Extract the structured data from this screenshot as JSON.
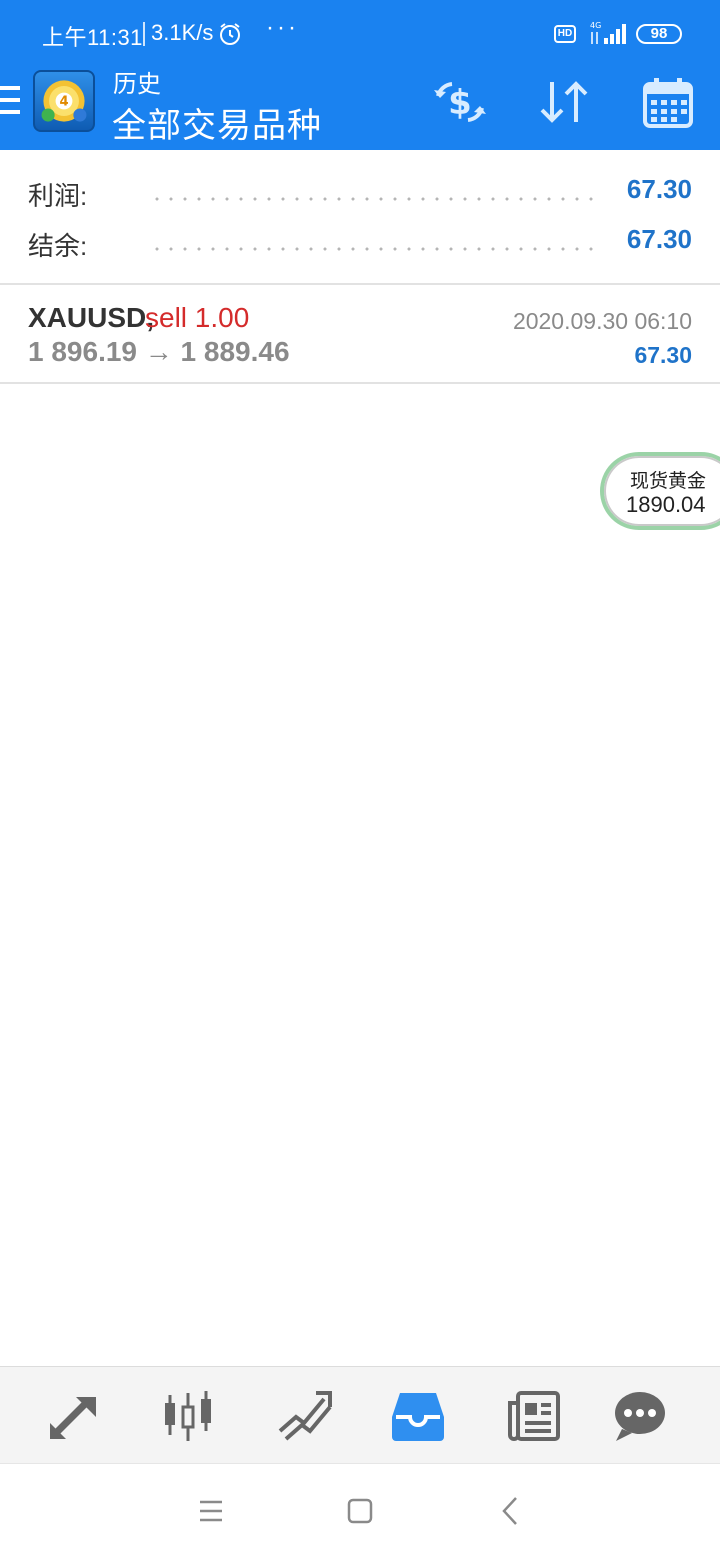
{
  "status_bar": {
    "time": "上午11:31",
    "network_speed": "3.1K/s",
    "more": "···",
    "hd_badge": "HD",
    "signal_label": "4G",
    "battery": "98"
  },
  "app_bar": {
    "title": "历史",
    "subtitle": "全部交易品种",
    "icons": [
      "menu-icon",
      "app-logo",
      "currency-exchange-icon",
      "sort-icon",
      "calendar-icon"
    ]
  },
  "summary": {
    "profit_label": "利润:",
    "profit_value": "67.30",
    "balance_label": "结余:",
    "balance_value": "67.30"
  },
  "trades": [
    {
      "symbol": "XAUUSD,",
      "side": "sell 1.00",
      "prices": "1 896.19 → 1 889.46",
      "datetime": "2020.09.30 06:10",
      "profit": "67.30"
    }
  ],
  "bubble": {
    "name": "现货黄金",
    "price": "1890.04"
  },
  "bottom_nav": {
    "items": [
      "quotes-icon",
      "chart-icon",
      "trade-icon",
      "history-icon",
      "news-icon",
      "chat-icon"
    ],
    "active": "history-icon",
    "active_color": "#2f8ff0",
    "inactive_color": "#666666"
  },
  "colors": {
    "header_blue": "#1a82f0",
    "profit_blue": "#1f73c9",
    "sell_red": "#d42b2b",
    "muted_gray": "#8a8a8a"
  }
}
